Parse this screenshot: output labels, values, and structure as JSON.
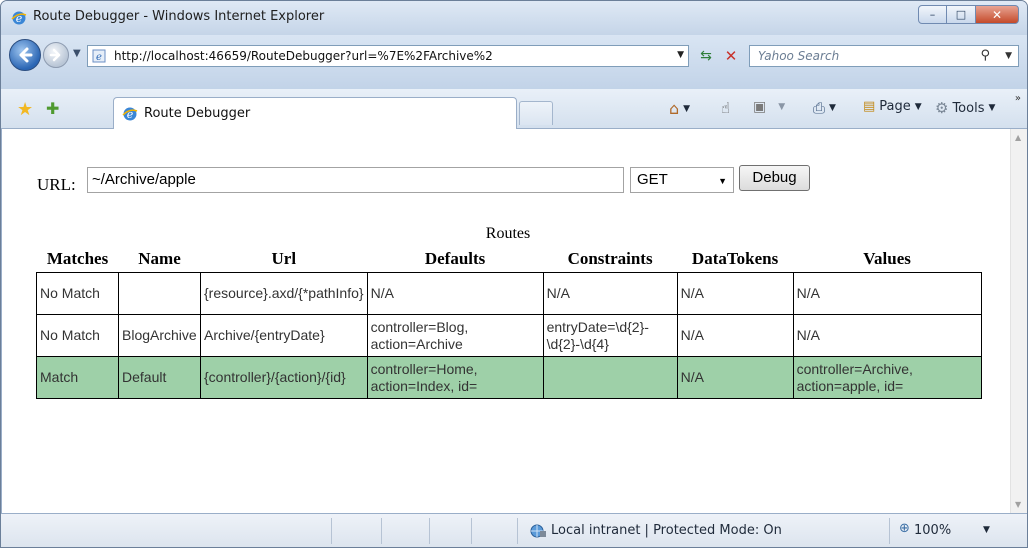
{
  "window": {
    "title": "Route Debugger - Windows Internet Explorer",
    "minimize_glyph": "–",
    "maximize_glyph": "□",
    "close_glyph": "✕"
  },
  "nav": {
    "url": "http://localhost:46659/RouteDebugger?url=%7E%2FArchive%2",
    "search_placeholder": "Yahoo Search"
  },
  "tabs": [
    {
      "label": "Route Debugger",
      "active": true
    }
  ],
  "commands": {
    "page_label": "Page",
    "tools_label": "Tools"
  },
  "form": {
    "url_label": "URL:",
    "url_value": "~/Archive/apple",
    "method_value": "GET",
    "debug_label": "Debug"
  },
  "table": {
    "caption": "Routes",
    "headers": [
      "Matches",
      "Name",
      "Url",
      "Defaults",
      "Constraints",
      "DataTokens",
      "Values"
    ],
    "rows": [
      {
        "match": false,
        "cells": [
          "No Match",
          "",
          "{resource}.axd/{*pathInfo}",
          "N/A",
          "N/A",
          "N/A",
          "N/A"
        ]
      },
      {
        "match": false,
        "cells": [
          "No Match",
          "BlogArchive",
          "Archive/{entryDate}",
          "controller=Blog, action=Archive",
          "entryDate=\\d{2}-\\d{2}-\\d{4}",
          "N/A",
          "N/A"
        ]
      },
      {
        "match": true,
        "cells": [
          "Match",
          "Default",
          "{controller}/{action}/{id}",
          "controller=Home, action=Index, id=",
          "",
          "N/A",
          "controller=Archive, action=apple, id="
        ]
      }
    ]
  },
  "status": {
    "zone": "Local intranet | Protected Mode: On",
    "zoom": "100%"
  },
  "colors": {
    "match_row": "#9ed0a8",
    "ie_blue": "#2b66b4"
  }
}
